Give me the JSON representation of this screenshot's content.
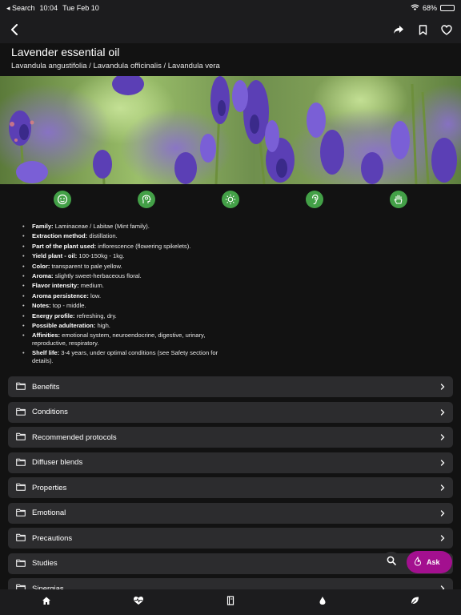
{
  "status_bar": {
    "back_app": "◂ Search",
    "time": "10:04",
    "date": "Tue Feb 10",
    "battery": "68%",
    "battery_level": 0.68
  },
  "nav": {
    "icons": [
      "back-icon",
      "share-icon",
      "bookmark-icon",
      "heart-icon"
    ]
  },
  "header": {
    "title": "Lavender essential oil",
    "subtitle": "Lavandula angustifolia / Lavandula officinalis / Lavandula vera"
  },
  "feature_icons": [
    "face-icon",
    "brain-profile-icon",
    "sun-icon",
    "ear-icon",
    "hand-icon"
  ],
  "facts": [
    {
      "label": "Family:",
      "value": " Laminaceae / Labitae (Mint family)."
    },
    {
      "label": "Extraction method:",
      "value": " distillation."
    },
    {
      "label": "Part of the plant used:",
      "value": " inflorescence (flowering spikelets)."
    },
    {
      "label": "Yield plant - oil:",
      "value": " 100-150kg - 1kg."
    },
    {
      "label": "Color:",
      "value": " transparent to pale yellow."
    },
    {
      "label": "Aroma:",
      "value": " slightly sweet-herbaceous floral."
    },
    {
      "label": "Flavor intensity:",
      "value": " medium."
    },
    {
      "label": "Aroma persistence:",
      "value": " low."
    },
    {
      "label": "Notes:",
      "value": " top - middle."
    },
    {
      "label": "Energy profile:",
      "value": " refreshing, dry."
    },
    {
      "label": "Possible adulteration:",
      "value": " high."
    },
    {
      "label": "Affinities:",
      "value": " emotional system, neuroendocrine, digestive, urinary, reproductive, respiratory."
    },
    {
      "label": "Shelf life:",
      "value": " 3-4 years, under optimal conditions (see Safety section for details)."
    }
  ],
  "sections": [
    "Benefits",
    "Conditions",
    "Recommended protocols",
    "Diffuser blends",
    "Properties",
    "Emotional",
    "Precautions",
    "Studies",
    "Sinergias"
  ],
  "fab": {
    "ask_label": "Ask"
  },
  "tab_bar": {
    "icons": [
      "home-icon",
      "heart-pulse-icon",
      "book-icon",
      "drop-icon",
      "leaf-icon"
    ]
  },
  "colors": {
    "accent_green": "#43a047",
    "ask_purple": "#a3108f",
    "row_bg": "#2c2c2e",
    "page_bg": "#121212"
  }
}
